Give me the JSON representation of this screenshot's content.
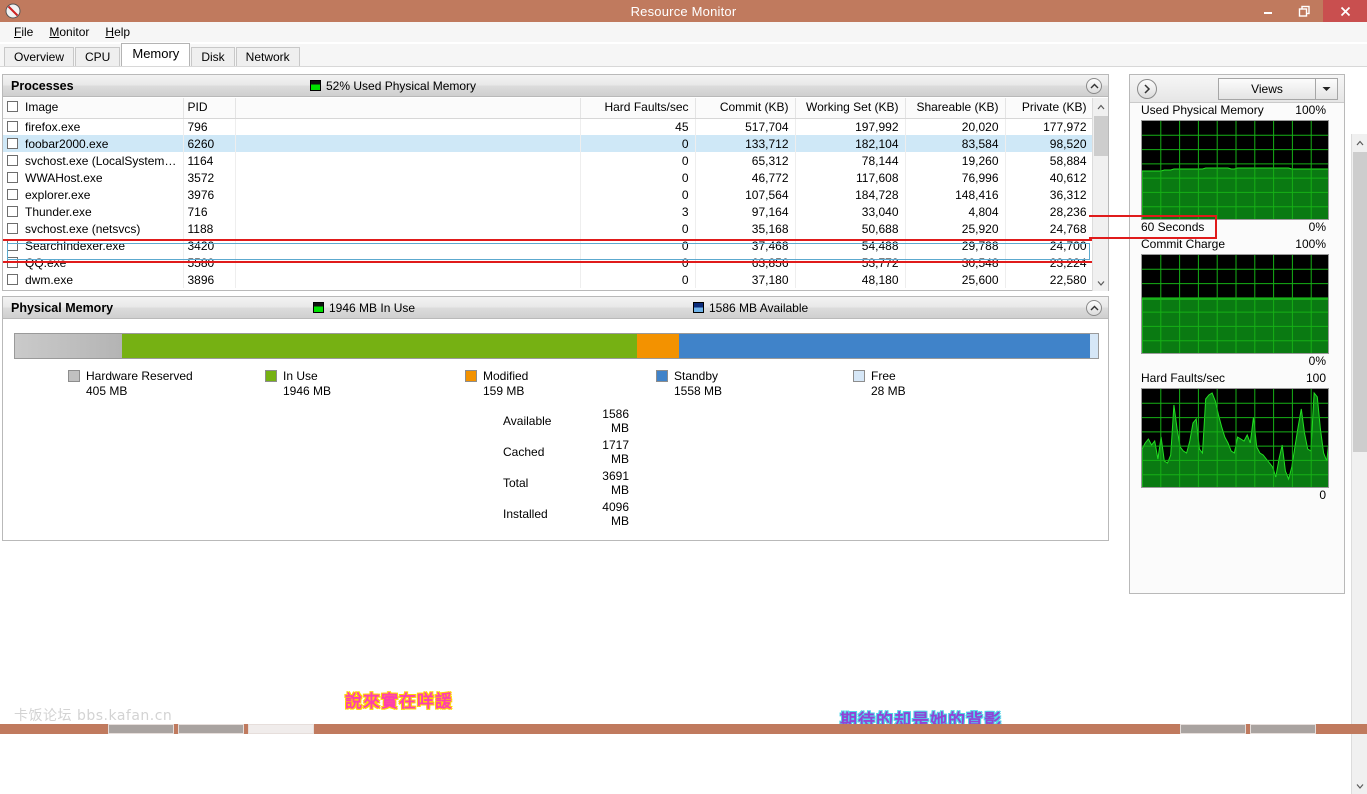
{
  "window": {
    "title": "Resource Monitor",
    "icon": "resource-monitor-icon",
    "minimize": "–",
    "maximize": "❐",
    "close": "✕"
  },
  "menubar": {
    "items": [
      {
        "label": "File",
        "accel": "F"
      },
      {
        "label": "Monitor",
        "accel": "M"
      },
      {
        "label": "Help",
        "accel": "H"
      }
    ]
  },
  "tabs": [
    {
      "label": "Overview",
      "active": false
    },
    {
      "label": "CPU",
      "active": false
    },
    {
      "label": "Memory",
      "active": true
    },
    {
      "label": "Disk",
      "active": false
    },
    {
      "label": "Network",
      "active": false
    }
  ],
  "processes_panel": {
    "title": "Processes",
    "status": "52% Used Physical Memory",
    "status_swatch": "green",
    "collapse_icon": "chevron-up-icon",
    "columns": [
      {
        "label": "Image",
        "align": "left"
      },
      {
        "label": "PID",
        "align": "left"
      },
      {
        "label": "",
        "align": "left"
      },
      {
        "label": "Hard Faults/sec",
        "align": "right"
      },
      {
        "label": "Commit (KB)",
        "align": "right"
      },
      {
        "label": "Working Set (KB)",
        "align": "right"
      },
      {
        "label": "Shareable (KB)",
        "align": "right"
      },
      {
        "label": "Private (KB)",
        "align": "right"
      }
    ],
    "rows": [
      {
        "image": "firefox.exe",
        "pid": "796",
        "blank": "",
        "hard_faults": "45",
        "commit": "517,704",
        "working_set": "197,992",
        "shareable": "20,020",
        "private": "177,972",
        "selected": false
      },
      {
        "image": "foobar2000.exe",
        "pid": "6260",
        "blank": "",
        "hard_faults": "0",
        "commit": "133,712",
        "working_set": "182,104",
        "shareable": "83,584",
        "private": "98,520",
        "selected": true
      },
      {
        "image": "svchost.exe (LocalSystemNet...",
        "pid": "1164",
        "blank": "",
        "hard_faults": "0",
        "commit": "65,312",
        "working_set": "78,144",
        "shareable": "19,260",
        "private": "58,884",
        "selected": false
      },
      {
        "image": "WWAHost.exe",
        "pid": "3572",
        "blank": "",
        "hard_faults": "0",
        "commit": "46,772",
        "working_set": "117,608",
        "shareable": "76,996",
        "private": "40,612",
        "selected": false
      },
      {
        "image": "explorer.exe",
        "pid": "3976",
        "blank": "",
        "hard_faults": "0",
        "commit": "107,564",
        "working_set": "184,728",
        "shareable": "148,416",
        "private": "36,312",
        "selected": false
      },
      {
        "image": "Thunder.exe",
        "pid": "716",
        "blank": "",
        "hard_faults": "3",
        "commit": "97,164",
        "working_set": "33,040",
        "shareable": "4,804",
        "private": "28,236",
        "selected": false
      },
      {
        "image": "svchost.exe (netsvcs)",
        "pid": "1188",
        "blank": "",
        "hard_faults": "0",
        "commit": "35,168",
        "working_set": "50,688",
        "shareable": "25,920",
        "private": "24,768",
        "selected": false
      },
      {
        "image": "SearchIndexer.exe",
        "pid": "3420",
        "blank": "",
        "hard_faults": "0",
        "commit": "37,468",
        "working_set": "54,488",
        "shareable": "29,788",
        "private": "24,700",
        "selected": false
      },
      {
        "image": "QQ.exe",
        "pid": "5580",
        "blank": "",
        "hard_faults": "0",
        "commit": "63,856",
        "working_set": "53,772",
        "shareable": "30,548",
        "private": "23,224",
        "selected": false
      },
      {
        "image": "dwm.exe",
        "pid": "3896",
        "blank": "",
        "hard_faults": "0",
        "commit": "37,180",
        "working_set": "48,180",
        "shareable": "25,600",
        "private": "22,580",
        "selected": false
      }
    ]
  },
  "memory_panel": {
    "title": "Physical Memory",
    "status_in_use": "1946 MB In Use",
    "status_available": "1586 MB Available",
    "collapse_icon": "chevron-up-icon",
    "bar_segments": [
      {
        "name": "Hardware Reserved",
        "value": "405 MB",
        "color": "#c0c0c0",
        "percent": 9.9
      },
      {
        "name": "In Use",
        "value": "1946 MB",
        "color": "#76b113",
        "percent": 47.5
      },
      {
        "name": "Modified",
        "value": "159 MB",
        "color": "#f39200",
        "percent": 3.9
      },
      {
        "name": "Standby",
        "value": "1558 MB",
        "color": "#4083c9",
        "percent": 38.0
      },
      {
        "name": "Free",
        "value": "28 MB",
        "color": "#d6e7f7",
        "percent": 0.7
      }
    ],
    "legend": [
      {
        "label": "Hardware Reserved",
        "value": "405 MB",
        "color": "#c0c0c0"
      },
      {
        "label": "In Use",
        "value": "1946 MB",
        "color": "#76b113"
      },
      {
        "label": "Modified",
        "value": "159 MB",
        "color": "#f39200"
      },
      {
        "label": "Standby",
        "value": "1558 MB",
        "color": "#4083c9"
      },
      {
        "label": "Free",
        "value": "28 MB",
        "color": "#d6e7f7"
      }
    ],
    "stats": [
      {
        "key": "Available",
        "value": "1586 MB"
      },
      {
        "key": "Cached",
        "value": "1717 MB"
      },
      {
        "key": "Total",
        "value": "3691 MB"
      },
      {
        "key": "Installed",
        "value": "4096 MB"
      }
    ]
  },
  "graphs_panel": {
    "expand_icon": "chevron-right-icon",
    "views_label": "Views",
    "views_dropdown_icon": "chevron-down-icon",
    "graphs": [
      {
        "title": "Used Physical Memory",
        "max_label": "100%",
        "min_label": "0%",
        "time_label": "60 Seconds",
        "has_time_label": true
      },
      {
        "title": "Commit Charge",
        "max_label": "100%",
        "min_label": "0%",
        "has_time_label": false
      },
      {
        "title": "Hard Faults/sec",
        "max_label": "100",
        "min_label": "0",
        "has_time_label": false
      }
    ]
  },
  "chart_data": [
    {
      "type": "area",
      "title": "Used Physical Memory",
      "ylabel": "%",
      "ylim": [
        0,
        100
      ],
      "xlabel": "60 Seconds",
      "grid": true,
      "series": [
        {
          "name": "Used Physical Memory",
          "values": [
            50,
            50,
            50,
            50,
            50,
            50,
            50,
            51,
            51,
            51,
            52,
            52,
            52,
            52,
            52,
            52,
            52,
            52,
            52,
            52,
            53,
            53,
            53,
            53,
            53,
            53,
            53,
            53,
            52,
            52,
            53,
            53,
            53,
            53,
            53,
            53,
            53,
            53,
            53,
            53,
            53,
            53,
            53,
            53,
            53,
            53,
            53,
            52,
            52,
            52,
            52,
            52,
            52,
            52,
            52,
            52,
            52,
            52,
            52,
            52
          ]
        }
      ]
    },
    {
      "type": "area",
      "title": "Commit Charge",
      "ylabel": "%",
      "ylim": [
        0,
        100
      ],
      "grid": true,
      "series": [
        {
          "name": "Commit Charge",
          "values": [
            56,
            56,
            56,
            56,
            56,
            56,
            56,
            56,
            56,
            56,
            56,
            56,
            56,
            56,
            56,
            56,
            56,
            56,
            56,
            56,
            56,
            56,
            56,
            56,
            56,
            56,
            56,
            56,
            56,
            56,
            56,
            56,
            56,
            56,
            56,
            56,
            56,
            56,
            56,
            56,
            56,
            56,
            56,
            56,
            56,
            56,
            56,
            56,
            56,
            56,
            56,
            56,
            56,
            56,
            56,
            56,
            56,
            56,
            56,
            56
          ]
        }
      ]
    },
    {
      "type": "area",
      "title": "Hard Faults/sec",
      "ylabel": "faults/sec",
      "ylim": [
        0,
        100
      ],
      "grid": true,
      "series": [
        {
          "name": "Hard Faults/sec",
          "values": [
            40,
            46,
            50,
            44,
            48,
            30,
            52,
            28,
            26,
            34,
            84,
            60,
            42,
            38,
            36,
            48,
            66,
            70,
            40,
            36,
            90,
            94,
            96,
            88,
            74,
            62,
            52,
            46,
            38,
            36,
            52,
            50,
            48,
            54,
            46,
            72,
            42,
            36,
            34,
            30,
            26,
            22,
            12,
            30,
            44,
            18,
            10,
            22,
            42,
            62,
            80,
            56,
            40,
            38,
            96,
            92,
            60,
            36,
            28,
            58
          ]
        }
      ]
    }
  ],
  "scrollbars": {
    "up_icon": "chevron-up-icon",
    "down_icon": "chevron-down-icon"
  },
  "watermarks": {
    "forum": "卡饭论坛 bbs.kafan.cn",
    "pink": "說來實在咩諼",
    "purple": "期待的却是她的背影"
  }
}
